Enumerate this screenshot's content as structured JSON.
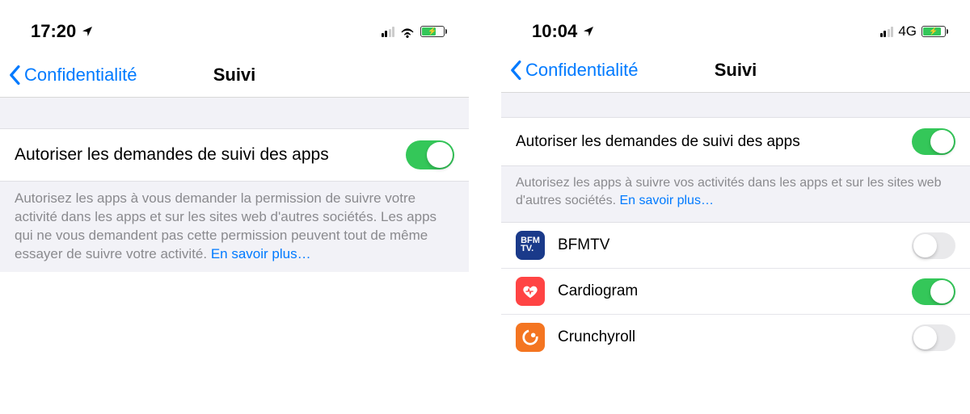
{
  "left": {
    "status": {
      "time": "17:20"
    },
    "nav": {
      "back": "Confidentialité",
      "title": "Suivi"
    },
    "allow": {
      "label": "Autoriser les demandes de suivi des apps",
      "on": true
    },
    "footer": {
      "text": "Autorisez les apps à vous demander la permission de suivre votre activité dans les apps et sur les sites web d'autres sociétés. Les apps qui ne vous demandent pas cette permission peuvent tout de même essayer de suivre votre activité. ",
      "link": "En savoir plus…"
    }
  },
  "right": {
    "status": {
      "time": "10:04",
      "net": "4G"
    },
    "nav": {
      "back": "Confidentialité",
      "title": "Suivi"
    },
    "allow": {
      "label": "Autoriser les demandes de suivi des apps",
      "on": true
    },
    "footer": {
      "text": "Autorisez les apps à suivre vos activités dans les apps et sur les sites web d'autres sociétés. ",
      "link": "En savoir plus…"
    },
    "apps": [
      {
        "name": "BFMTV",
        "on": false,
        "icon": "bfmtv"
      },
      {
        "name": "Cardiogram",
        "on": true,
        "icon": "cardiogram"
      },
      {
        "name": "Crunchyroll",
        "on": false,
        "icon": "crunchyroll"
      }
    ]
  }
}
